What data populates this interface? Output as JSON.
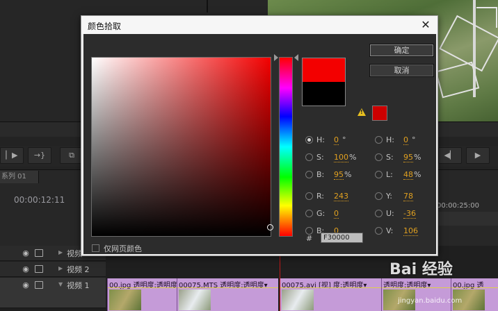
{
  "dialog": {
    "title": "颜色拾取",
    "close_glyph": "✕",
    "ok_label": "确定",
    "cancel_label": "取消",
    "warning_glyph": "!",
    "hex_label": "#",
    "hex_value": "F30000",
    "websafe_label": "仅网页颜色",
    "new_color": "#f30000",
    "old_color": "#000000",
    "websafe_color": "#cc0000",
    "hsb": {
      "h": {
        "label": "H:",
        "value": "0",
        "unit": "°"
      },
      "s": {
        "label": "S:",
        "value": "100",
        "unit": "%"
      },
      "b": {
        "label": "B:",
        "value": "95",
        "unit": "%"
      }
    },
    "hsl": {
      "h": {
        "label": "H:",
        "value": "0",
        "unit": "°"
      },
      "s": {
        "label": "S:",
        "value": "95",
        "unit": "%"
      },
      "l": {
        "label": "L:",
        "value": "48",
        "unit": "%"
      }
    },
    "rgb": {
      "r": {
        "label": "R:",
        "value": "243"
      },
      "g": {
        "label": "G:",
        "value": "0"
      },
      "b": {
        "label": "B:",
        "value": "0"
      }
    },
    "yuv": {
      "y": {
        "label": "Y:",
        "value": "78"
      },
      "u": {
        "label": "U:",
        "value": "-36"
      },
      "v": {
        "label": "V:",
        "value": "106"
      }
    }
  },
  "editor": {
    "sequence_tab": "系列 01",
    "timecode": "00:00:12:11",
    "ruler_time": "00:00:25:00",
    "tracks": [
      {
        "label": "视频"
      },
      {
        "label": "视频 2"
      },
      {
        "label": "视频 1"
      }
    ],
    "clips": [
      {
        "label": "00.jpg 透明度:透明度▾"
      },
      {
        "label": "00075.MTS 透明度:透明度▾"
      },
      {
        "label": "00075.avi [视] 度:透明度▾"
      },
      {
        "label": "透明度:透明度▾"
      },
      {
        "label": "00.jpg 透"
      }
    ]
  },
  "watermark": {
    "text": "Bai 经验",
    "sub": "jingyan.baidu.com"
  }
}
